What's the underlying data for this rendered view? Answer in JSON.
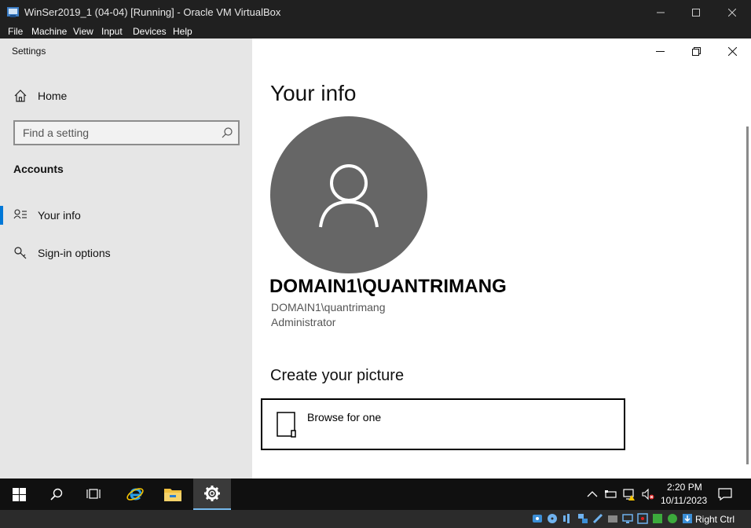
{
  "host": {
    "title": "WinSer2019_1 (04-04) [Running] - Oracle VM VirtualBox",
    "menu": [
      "File",
      "Machine",
      "View",
      "Input",
      "Devices",
      "Help"
    ],
    "host_key": "Right Ctrl"
  },
  "settings": {
    "app_title": "Settings",
    "home_label": "Home",
    "search_placeholder": "Find a setting",
    "section_title": "Accounts",
    "nav": [
      {
        "label": "Your info",
        "icon": "person-list-icon",
        "selected": true
      },
      {
        "label": "Sign-in options",
        "icon": "key-icon",
        "selected": false
      }
    ]
  },
  "main": {
    "page_title": "Your info",
    "display_name": "DOMAIN1\\QUANTRIMANG",
    "account": "DOMAIN1\\quantrimang",
    "role": "Administrator",
    "create_picture_title": "Create your picture",
    "browse_label": "Browse for one"
  },
  "taskbar": {
    "time": "2:20 PM",
    "date": "10/11/2023"
  },
  "colors": {
    "accent": "#0078d7",
    "avatar_bg": "#666666",
    "sidebar_bg": "#e6e6e6"
  }
}
